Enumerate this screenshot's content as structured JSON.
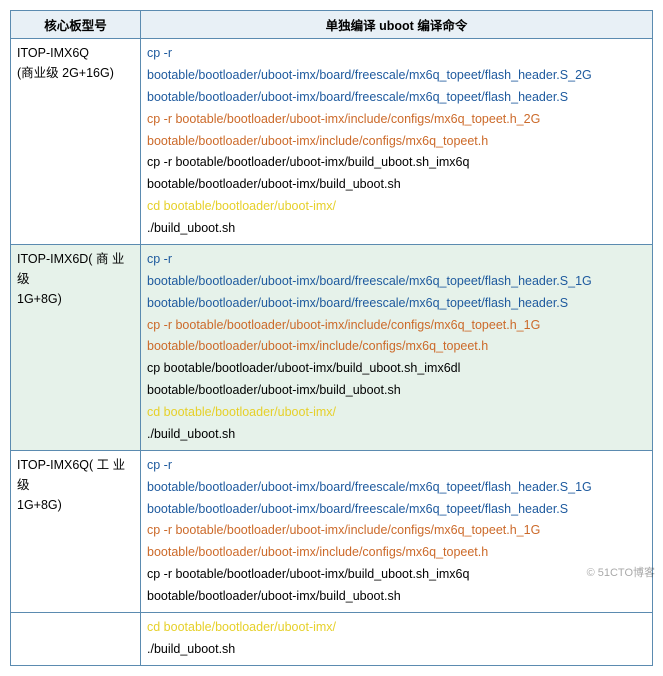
{
  "headers": {
    "model": "核心板型号",
    "cmd": "单独编译 uboot 编译命令"
  },
  "rows": [
    {
      "bg": "bg-plain",
      "model": "ITOP-IMX6Q\n(商业级  2G+16G)",
      "lines": [
        {
          "cls": "c-blue",
          "text": "cp -r"
        },
        {
          "cls": "c-blue",
          "text": "bootable/bootloader/uboot-imx/board/freescale/mx6q_topeet/flash_header.S_2G"
        },
        {
          "cls": "c-blue",
          "text": "bootable/bootloader/uboot-imx/board/freescale/mx6q_topeet/flash_header.S"
        },
        {
          "cls": "c-orange",
          "text": "cp -r bootable/bootloader/uboot-imx/include/configs/mx6q_topeet.h_2G"
        },
        {
          "cls": "c-orange",
          "text": "bootable/bootloader/uboot-imx/include/configs/mx6q_topeet.h"
        },
        {
          "cls": "c-black",
          "text": "cp -r bootable/bootloader/uboot-imx/build_uboot.sh_imx6q"
        },
        {
          "cls": "c-black",
          "text": "bootable/bootloader/uboot-imx/build_uboot.sh"
        },
        {
          "cls": "c-yellow",
          "text": "cd bootable/bootloader/uboot-imx/"
        },
        {
          "cls": "c-black",
          "text": "./build_uboot.sh"
        }
      ]
    },
    {
      "bg": "bg-green",
      "model": "ITOP-IMX6D( 商 业 级\n1G+8G)",
      "lines": [
        {
          "cls": "c-blue",
          "text": "cp -r"
        },
        {
          "cls": "c-blue",
          "text": "bootable/bootloader/uboot-imx/board/freescale/mx6q_topeet/flash_header.S_1G"
        },
        {
          "cls": "c-blue",
          "text": "bootable/bootloader/uboot-imx/board/freescale/mx6q_topeet/flash_header.S"
        },
        {
          "cls": "c-orange",
          "text": "cp -r bootable/bootloader/uboot-imx/include/configs/mx6q_topeet.h_1G"
        },
        {
          "cls": "c-orange",
          "text": "bootable/bootloader/uboot-imx/include/configs/mx6q_topeet.h"
        },
        {
          "cls": "c-black",
          "text": "cp bootable/bootloader/uboot-imx/build_uboot.sh_imx6dl"
        },
        {
          "cls": "c-black",
          "text": "bootable/bootloader/uboot-imx/build_uboot.sh"
        },
        {
          "cls": "c-yellow",
          "text": "cd bootable/bootloader/uboot-imx/"
        },
        {
          "cls": "c-black",
          "text": "./build_uboot.sh"
        }
      ]
    },
    {
      "bg": "bg-plain",
      "model": "ITOP-IMX6Q( 工 业 级\n1G+8G)",
      "lines": [
        {
          "cls": "c-blue",
          "text": "cp -r"
        },
        {
          "cls": "c-blue",
          "text": "bootable/bootloader/uboot-imx/board/freescale/mx6q_topeet/flash_header.S_1G"
        },
        {
          "cls": "c-blue",
          "text": "bootable/bootloader/uboot-imx/board/freescale/mx6q_topeet/flash_header.S"
        },
        {
          "cls": "c-orange",
          "text": "cp -r bootable/bootloader/uboot-imx/include/configs/mx6q_topeet.h_1G"
        },
        {
          "cls": "c-orange",
          "text": "bootable/bootloader/uboot-imx/include/configs/mx6q_topeet.h"
        },
        {
          "cls": "c-black",
          "text": "cp -r bootable/bootloader/uboot-imx/build_uboot.sh_imx6q"
        },
        {
          "cls": "c-black",
          "text": "bootable/bootloader/uboot-imx/build_uboot.sh"
        }
      ]
    },
    {
      "bg": "bg-plain",
      "model": "",
      "lines": [
        {
          "cls": "c-yellow",
          "text": "cd bootable/bootloader/uboot-imx/"
        },
        {
          "cls": "c-black",
          "text": "./build_uboot.sh"
        }
      ]
    }
  ],
  "watermark": "© 51CTO博客"
}
